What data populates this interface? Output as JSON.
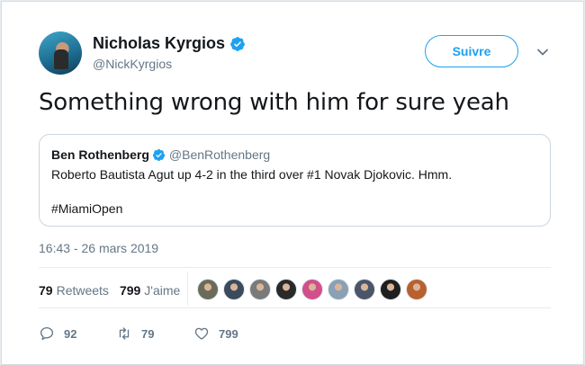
{
  "author": {
    "name": "Nicholas Kyrgios",
    "handle": "@NickKyrgios",
    "verified_icon": "verified-badge-icon"
  },
  "follow_label": "Suivre",
  "tweet_text": "Something wrong with him for sure yeah",
  "quote": {
    "name": "Ben Rothenberg",
    "handle": "@BenRothenberg",
    "text": "Roberto Bautista Agut up 4-2 in the third over #1 Novak Djokovic. Hmm.",
    "hashtag": "#MiamiOpen"
  },
  "timestamp": "16:43 - 26 mars 2019",
  "stats": {
    "retweets_count": "79",
    "retweets_label": "Retweets",
    "likes_count": "799",
    "likes_label": "J'aime"
  },
  "likers": [
    {
      "color": "#6b6b5a"
    },
    {
      "color": "#3d4a5c"
    },
    {
      "color": "#7a7a7a"
    },
    {
      "color": "#2a2a2a"
    },
    {
      "color": "#d14f8a"
    },
    {
      "color": "#8aa0b5"
    },
    {
      "color": "#4a5568"
    },
    {
      "color": "#1f1f1f"
    },
    {
      "color": "#b8612f"
    }
  ],
  "actions": {
    "replies": "92",
    "retweets": "79",
    "likes": "799"
  },
  "colors": {
    "accent": "#1da1f2",
    "secondary_text": "#657786",
    "border": "#ccd6dd"
  }
}
